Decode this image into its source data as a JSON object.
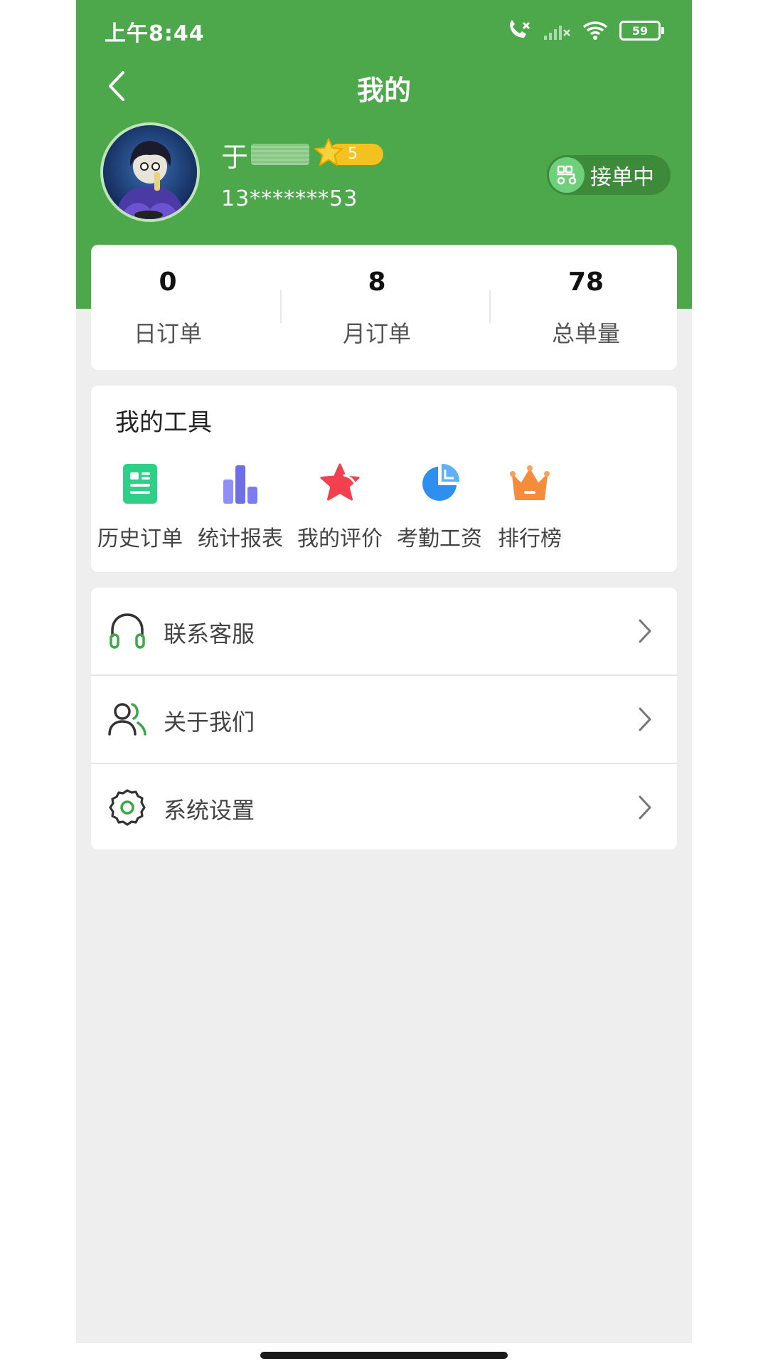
{
  "status_bar": {
    "time": "上午8:44",
    "battery": "59"
  },
  "nav": {
    "title": "我的"
  },
  "user": {
    "name": "于",
    "level": "5",
    "phone": "13*******53"
  },
  "work_status": {
    "label": "接单中"
  },
  "stats": [
    {
      "value": "0",
      "label": "日订单"
    },
    {
      "value": "8",
      "label": "月订单"
    },
    {
      "value": "78",
      "label": "总单量"
    }
  ],
  "tools": {
    "title": "我的工具",
    "items": [
      {
        "label": "历史订单",
        "icon": "order-list-icon",
        "color": "#2ecf87"
      },
      {
        "label": "统计报表",
        "icon": "bar-chart-icon",
        "color": "#7b7cf0"
      },
      {
        "label": "我的评价",
        "icon": "star-icon",
        "color": "#f2404e"
      },
      {
        "label": "考勤工资",
        "icon": "pie-chart-icon",
        "color": "#2f8ff0"
      },
      {
        "label": "排行榜",
        "icon": "crown-icon",
        "color": "#f58c3c"
      }
    ]
  },
  "menu": [
    {
      "label": "联系客服",
      "icon": "headset-icon"
    },
    {
      "label": "关于我们",
      "icon": "users-icon"
    },
    {
      "label": "系统设置",
      "icon": "settings-gear-icon"
    }
  ],
  "colors": {
    "primary": "#4ca84a",
    "background": "#eeeeee",
    "level_badge": "#f4c21f",
    "toggle": "#3d8a3b"
  }
}
